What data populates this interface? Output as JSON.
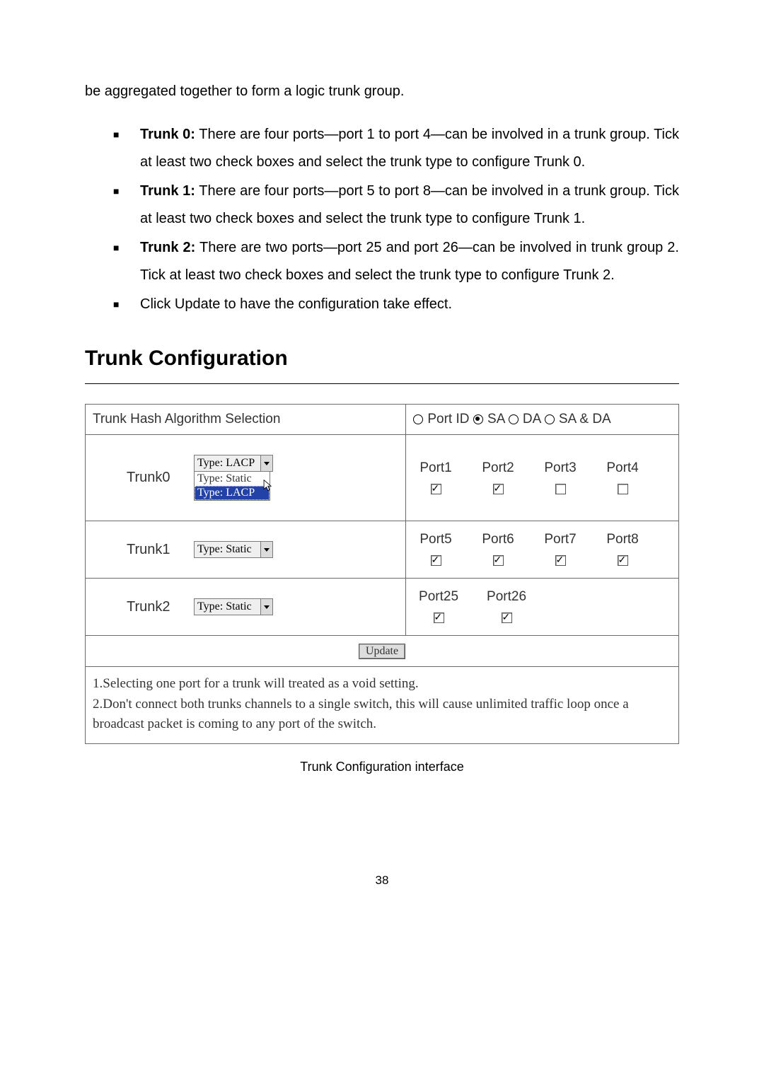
{
  "intro": "be aggregated together to form a logic trunk group.",
  "bullets": [
    {
      "label": "Trunk 0:",
      "text": " There are four ports—port 1 to port 4—can be involved in a trunk group. Tick at least two check boxes and select the trunk type to configure Trunk 0."
    },
    {
      "label": "Trunk 1:",
      "text": " There are four ports—port 5 to port 8—can be involved in a trunk group. Tick at least two check boxes and select the trunk type to configure Trunk 1."
    },
    {
      "label": "Trunk 2:",
      "text": " There are two ports—port 25 and port 26—can be involved in trunk group 2. Tick at least two check boxes and select the trunk type to configure Trunk 2."
    },
    {
      "label": "",
      "text": "Click Update to have the configuration take effect."
    }
  ],
  "section_title": "Trunk Configuration",
  "hash_label": "Trunk Hash Algorithm Selection",
  "radios": {
    "portid": "Port ID",
    "sa": "SA",
    "da": "DA",
    "sada": "SA & DA"
  },
  "trunk0": {
    "name": "Trunk0",
    "select": "Type: LACP",
    "opt_static": "Type: Static",
    "opt_lacp": "Type: LACP",
    "ports": [
      "Port1",
      "Port2",
      "Port3",
      "Port4"
    ]
  },
  "trunk1": {
    "name": "Trunk1",
    "select": "Type: Static",
    "ports": [
      "Port5",
      "Port6",
      "Port7",
      "Port8"
    ]
  },
  "trunk2": {
    "name": "Trunk2",
    "select": "Type: Static",
    "ports": [
      "Port25",
      "Port26"
    ]
  },
  "update": "Update",
  "note1": "1.Selecting one port for a trunk will treated as a void setting.",
  "note2": "2.Don't connect both trunks channels to a single switch, this will cause unlimited traffic loop once a broadcast packet is coming to any port of the switch.",
  "caption": "Trunk Configuration interface",
  "page_number": "38"
}
